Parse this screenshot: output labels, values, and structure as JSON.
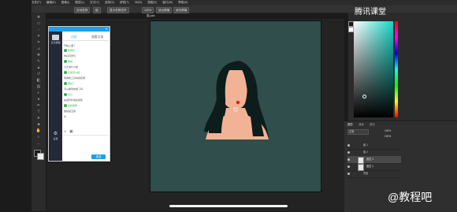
{
  "menubar": [
    "文件(F)",
    "编辑(E)",
    "图像(I)",
    "图层(L)",
    "文字(Y)",
    "选择(S)",
    "滤镜(T)",
    "3D(D)",
    "视图(V)",
    "窗口(W)",
    "帮助(H)"
  ],
  "options": {
    "auto_select": "自动选择",
    "group": "组",
    "show_transform": "显示变换控件",
    "zoom_pct": "100%",
    "fit_screen": "适合屏幕",
    "fill_screen": "填充屏幕"
  },
  "doc_tab": "猫.psd",
  "brand": "腾讯课堂",
  "watermark": "@教程吧",
  "panel": {
    "tabs": [
      "讨论",
      "观看记录"
    ],
    "left_items": [
      "互动课程",
      "设置"
    ],
    "messages": [
      {
        "text": "开始上课了",
        "green": false
      },
      {
        "text": "老师好",
        "green": true
      },
      {
        "text": "你好同学们",
        "green": false
      },
      {
        "text": "收到",
        "green": true
      },
      {
        "text": "今天讲什么呢",
        "green": false
      },
      {
        "text": "头发怎么画",
        "green": true
      },
      {
        "text": "用钢笔工具勾勒轮廓",
        "green": false
      },
      {
        "text": "明白了",
        "green": true
      },
      {
        "text": "可以看到效果了吗",
        "green": false
      },
      {
        "text": "可以",
        "green": true
      },
      {
        "text": "先把形状填充颜色",
        "green": false
      },
      {
        "text": "好的老师",
        "green": true
      },
      {
        "text": "继续画五官",
        "green": false
      },
      {
        "text": "好",
        "green": false
      }
    ],
    "send_button": "发送"
  },
  "colors": {
    "canvas_bg": "#2f4e4c",
    "skin": "#f2b295",
    "hair": "#0c1d1c",
    "accent": "#1e9fe6"
  },
  "layers": {
    "tabs": [
      "图层",
      "通道",
      "路径"
    ],
    "mode": "正常",
    "opacity": "100%",
    "fill": "100%",
    "rows": [
      "组 1",
      "组 2",
      "图层 3",
      "图层 2",
      "背景"
    ]
  }
}
